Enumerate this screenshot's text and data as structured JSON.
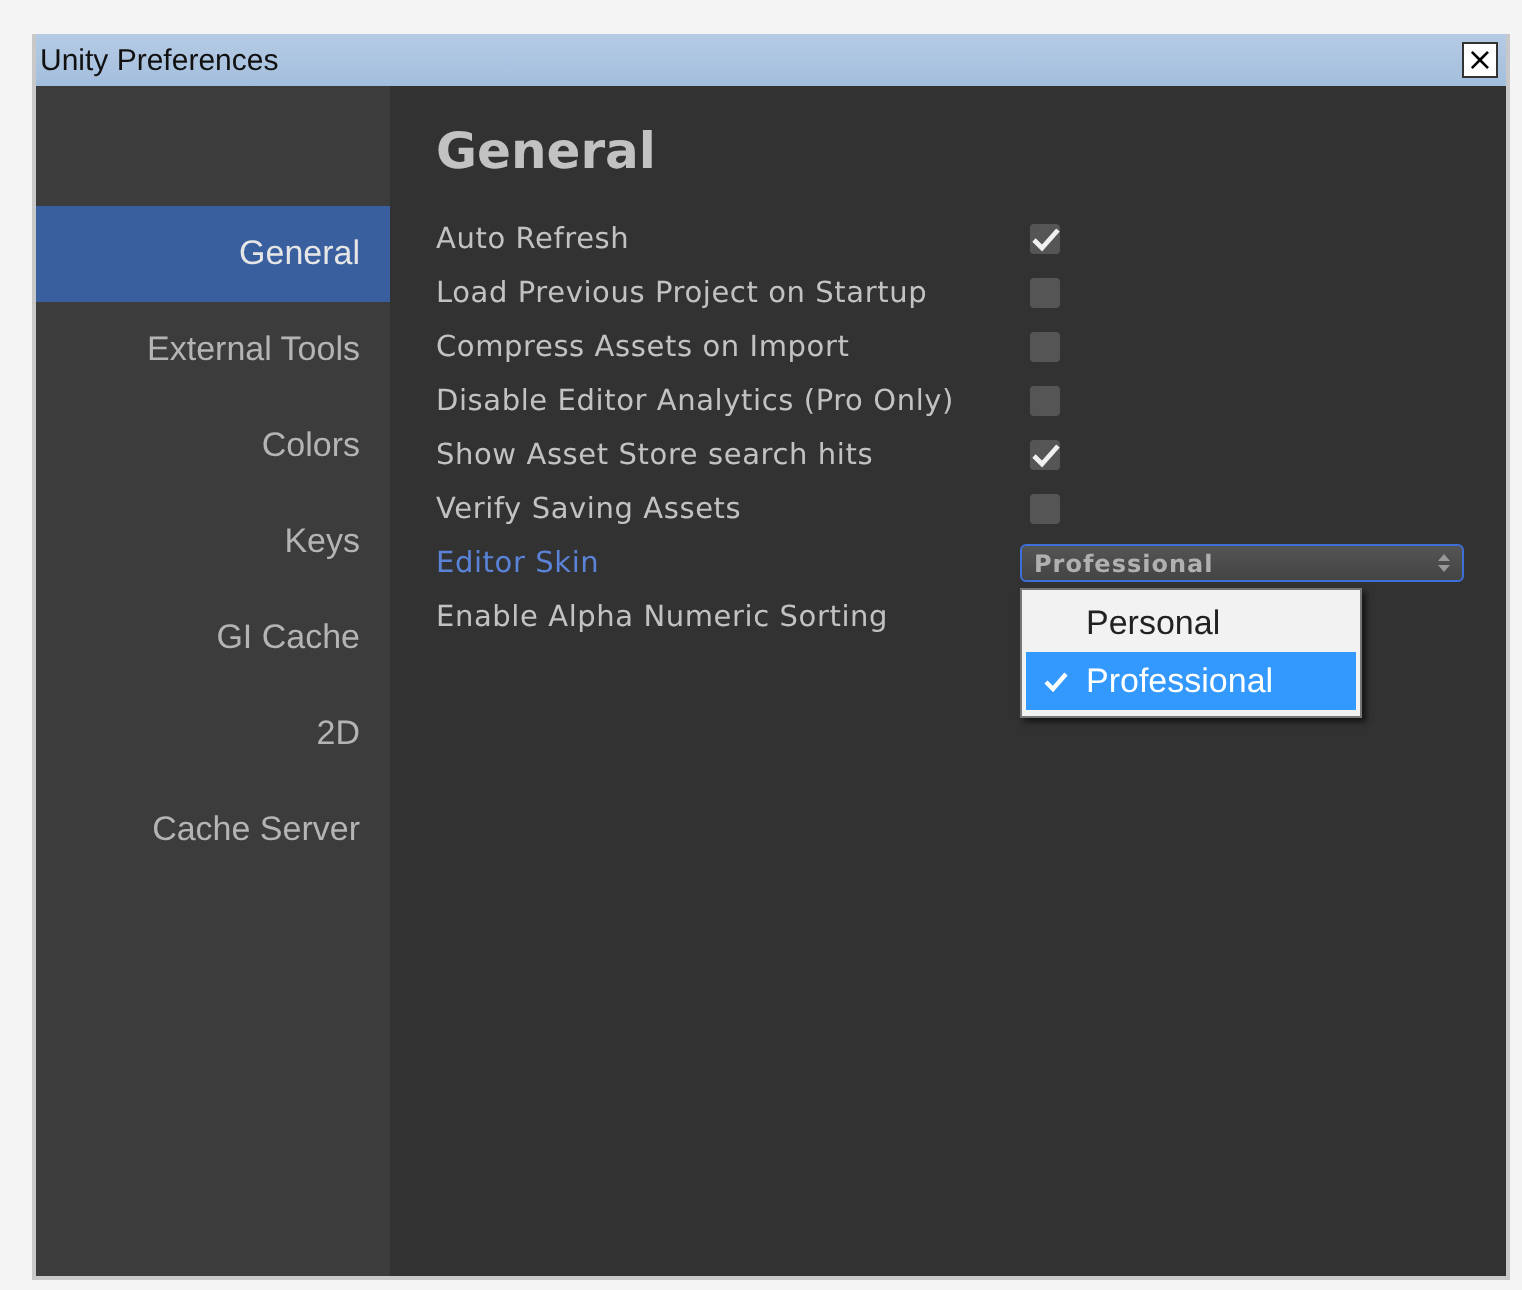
{
  "window": {
    "title": "Unity Preferences",
    "close": "×"
  },
  "sidebar": {
    "items": [
      {
        "label": "General",
        "selected": true
      },
      {
        "label": "External Tools",
        "selected": false
      },
      {
        "label": "Colors",
        "selected": false
      },
      {
        "label": "Keys",
        "selected": false
      },
      {
        "label": "GI Cache",
        "selected": false
      },
      {
        "label": "2D",
        "selected": false
      },
      {
        "label": "Cache Server",
        "selected": false
      }
    ]
  },
  "content": {
    "heading": "General",
    "settings": [
      {
        "kind": "checkbox",
        "label": "Auto Refresh",
        "checked": true,
        "focused": false
      },
      {
        "kind": "checkbox",
        "label": "Load Previous Project on Startup",
        "checked": false,
        "focused": false
      },
      {
        "kind": "checkbox",
        "label": "Compress Assets on Import",
        "checked": false,
        "focused": false
      },
      {
        "kind": "checkbox",
        "label": "Disable Editor Analytics (Pro Only)",
        "checked": false,
        "focused": false
      },
      {
        "kind": "checkbox",
        "label": "Show Asset Store search hits",
        "checked": true,
        "focused": false
      },
      {
        "kind": "checkbox",
        "label": "Verify Saving Assets",
        "checked": false,
        "focused": false
      },
      {
        "kind": "dropdown",
        "label": "Editor Skin",
        "value": "Professional",
        "focused": true,
        "expanded": true,
        "options": [
          {
            "label": "Personal",
            "selected": false
          },
          {
            "label": "Professional",
            "selected": true
          }
        ]
      },
      {
        "kind": "plain",
        "label": "Enable Alpha Numeric Sorting",
        "focused": false
      }
    ]
  }
}
